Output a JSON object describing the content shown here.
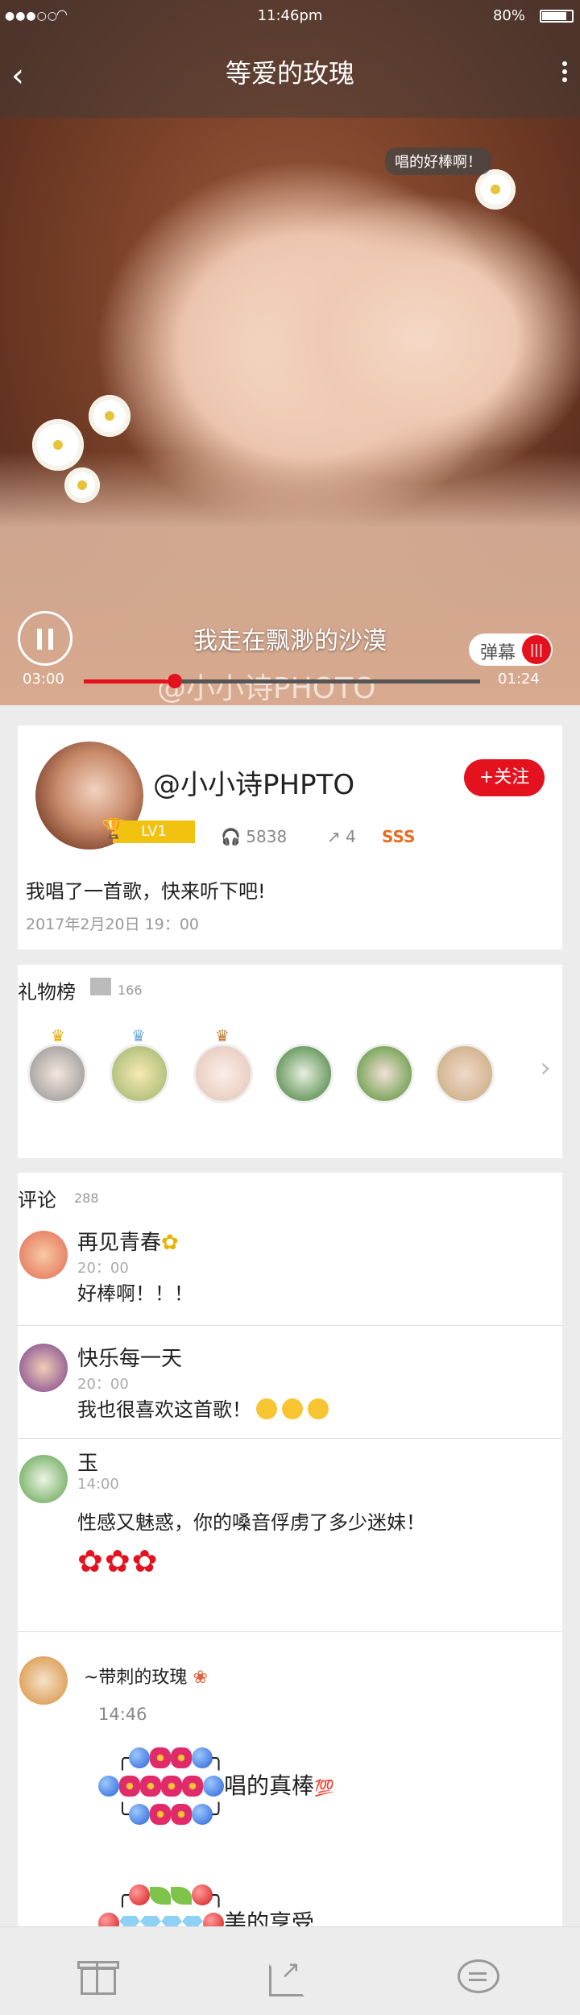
{
  "status_bar": {
    "signal": "●●●○○",
    "time": "11:46pm",
    "battery": "80%"
  },
  "nav": {
    "title": "等爱的玫瑰"
  },
  "player": {
    "danmu_bubble": "唱的好棒啊！",
    "lyric": "我走在飘渺的沙漠",
    "watermark": "@小小诗PHOTO",
    "current_time": "03:00",
    "total_time": "01:24",
    "progress": 0.23,
    "danmu_toggle_label": "弹幕",
    "danmu_toggle_icon": "|||"
  },
  "profile": {
    "username": "@小小诗PHPTO",
    "level": "LV1",
    "follow_label": "+关注",
    "listens": "5838",
    "shares": "4",
    "badge": "SSS",
    "caption": "我唱了一首歌，快来听下吧!",
    "date": "2017年2月20日 19：00"
  },
  "gifts": {
    "title": "礼物榜",
    "count": "166",
    "crowns": [
      "gold-crown",
      "silver-crown",
      "bronze-crown"
    ]
  },
  "comments": {
    "title": "评论",
    "count": "288",
    "items": [
      {
        "name": "再见青春",
        "time": "20：00",
        "text": "好棒啊！！！"
      },
      {
        "name": "快乐每一天",
        "time": "20：00",
        "text": "我也很喜欢这首歌！"
      },
      {
        "name": "玉",
        "time": "14:00",
        "text": "性感又魅惑，你的嗓音俘虏了多少迷妹！"
      },
      {
        "name": "~带刺的玫瑰",
        "time": "14:46",
        "text1": "唱的真棒",
        "text1_suffix": "💯",
        "text2": "美的享受"
      }
    ]
  },
  "icons": {
    "back": "chevron-left-icon",
    "more": "more-vertical-icon",
    "gift": "gift-icon",
    "share": "share-icon",
    "comment": "chat-bubble-icon"
  },
  "colors": {
    "accent": "#e4121f",
    "level": "#f2c211",
    "badge": "#e96b1e"
  }
}
